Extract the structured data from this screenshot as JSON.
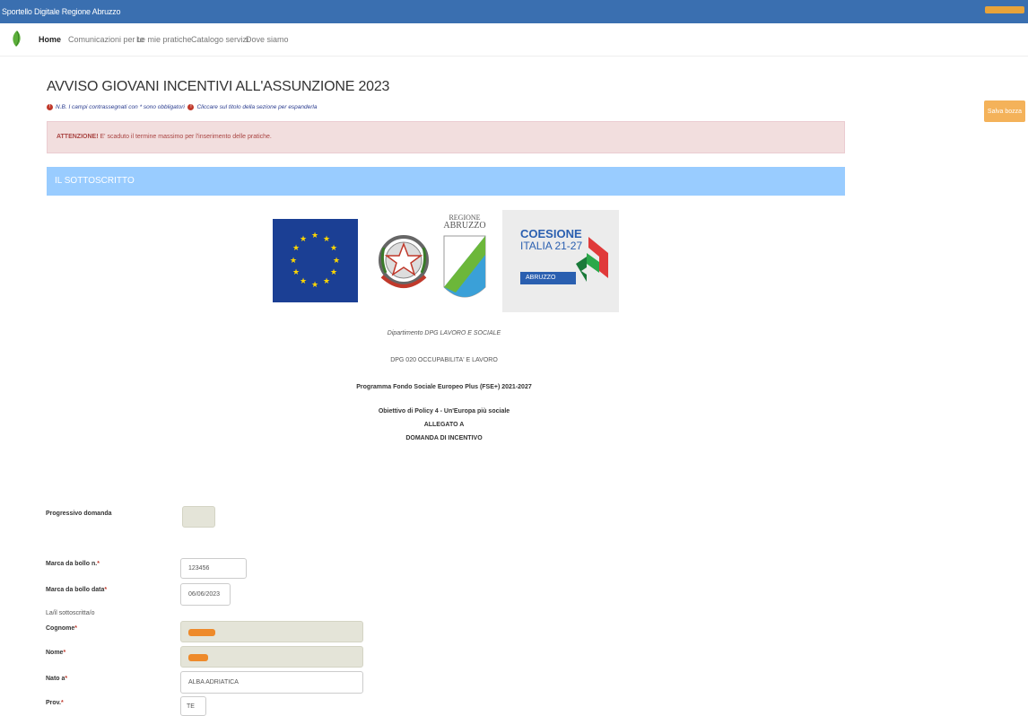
{
  "window": {
    "title": "Sportello Digitale Regione Abruzzo"
  },
  "nav": [
    {
      "label": "Home",
      "active": true
    },
    {
      "label": "Comunicazioni per te",
      "active": false
    },
    {
      "label": "Le mie pratiche",
      "active": false
    },
    {
      "label": "Catalogo servizi",
      "active": false
    },
    {
      "label": "Dove siamo",
      "active": false
    }
  ],
  "page": {
    "title": "AVVISO GIOVANI INCENTIVI ALL'ASSUNZIONE 2023",
    "hint1": "N.B. I campi contrassegnati con * sono obbligatori",
    "hint2": "Cliccare sul titolo della sezione per espanderla",
    "save_label": "Salva bozza",
    "alert_strong": "ATTENZIONE!",
    "alert_text": " E' scaduto il termine massimo per l'inserimento delle pratiche.",
    "section_title": "IL SOTTOSCRITTO"
  },
  "logos": {
    "region_line1": "REGIONE",
    "region_line2": "ABRUZZO",
    "coesione_line1": "COESIONE",
    "coesione_line2": "ITALIA 21-27",
    "coesione_badge": "ABRUZZO"
  },
  "header_text": {
    "dept": "Dipartimento DPG LAVORO E SOCIALE",
    "office": "DPG 020 OCCUPABILITA' E LAVORO",
    "programme": "Programma Fondo Sociale Europeo Plus (FSE+) 2021-2027",
    "objective": "Obiettivo di Policy 4 - Un'Europa più sociale",
    "allegato": "ALLEGATO A",
    "domanda": "DOMANDA DI INCENTIVO"
  },
  "form": {
    "progressivo_label": "Progressivo domanda",
    "progressivo_value": "",
    "bollo_n_label": "Marca da bollo n.",
    "bollo_n_value": "123456",
    "bollo_data_label": "Marca da bollo data",
    "bollo_data_value": "06/06/2023",
    "sottoscritto_label": "La/il sottoscritta/o",
    "cognome_label": "Cognome",
    "nome_label": "Nome",
    "nato_label": "Nato a",
    "nato_value": "ALBA ADRIATICA",
    "prov_label": "Prov.",
    "prov_value": "TE",
    "required_mark": "*"
  },
  "colors": {
    "topbar": "#3a6fb0",
    "section": "#99ccff",
    "alert_bg": "#f2dede",
    "save_button": "#f4b25a"
  }
}
